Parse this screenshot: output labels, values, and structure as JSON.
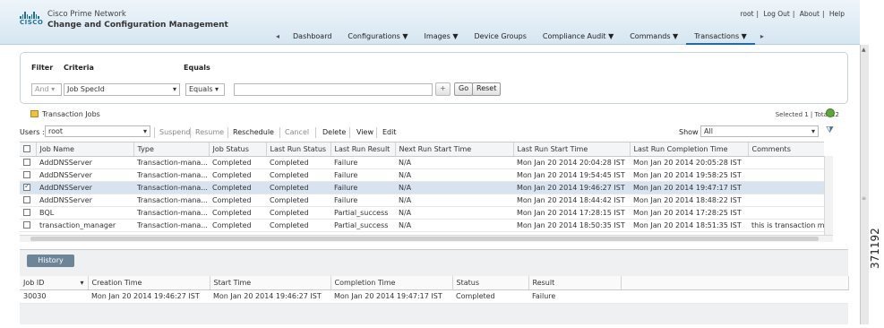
{
  "header": {
    "brand_line1": "Cisco Prime Network",
    "brand_line2": "Change and Configuration Management",
    "logo_text": "CISCO",
    "top_links": [
      "root",
      "Log Out",
      "About",
      "Help"
    ],
    "nav": [
      "Dashboard",
      "Configurations ▼",
      "Images ▼",
      "Device Groups",
      "Compliance Audit ▼",
      "Commands ▼",
      "Transactions ▼"
    ],
    "nav_left_arrow": "◂",
    "nav_right_arrow": "▸"
  },
  "filter": {
    "filter_label": "Filter",
    "criteria_label": "Criteria",
    "equals_label": "Equals",
    "and_select": "And",
    "criteria_select": "Job SpecId",
    "equals_select": "Equals",
    "value_input": "",
    "plus": "+",
    "go_label": "Go",
    "reset_label": "Reset"
  },
  "jobs": {
    "title": "Transaction Jobs",
    "selected_total": "Selected 1 | Total 12",
    "users_label": "Users :",
    "users_value": "root",
    "show_label": "Show",
    "show_value": "All",
    "actions": [
      {
        "label": "Suspend",
        "enabled": false
      },
      {
        "label": "Resume",
        "enabled": false
      },
      {
        "label": "Reschedule",
        "enabled": true
      },
      {
        "label": "Cancel",
        "enabled": false
      },
      {
        "label": "Delete",
        "enabled": true
      },
      {
        "label": "View",
        "enabled": true
      },
      {
        "label": "Edit",
        "enabled": true
      }
    ],
    "columns": [
      "Job Name",
      "Type",
      "Job Status",
      "Last Run Status",
      "Last Run Result",
      "Next Run Start Time",
      "Last Run Start Time",
      "Last Run Completion Time",
      "Comments"
    ],
    "rows": [
      {
        "checked": false,
        "cells": [
          "AddDNSServer",
          "Transaction-mana...",
          "Completed",
          "Completed",
          "Failure",
          "N/A",
          "Mon Jan 20 2014 20:04:28 IST",
          "Mon Jan 20 2014 20:05:28 IST",
          ""
        ]
      },
      {
        "checked": false,
        "cells": [
          "AddDNSServer",
          "Transaction-mana...",
          "Completed",
          "Completed",
          "Failure",
          "N/A",
          "Mon Jan 20 2014 19:54:45 IST",
          "Mon Jan 20 2014 19:58:25 IST",
          ""
        ]
      },
      {
        "checked": true,
        "cells": [
          "AddDNSServer",
          "Transaction-mana...",
          "Completed",
          "Completed",
          "Failure",
          "N/A",
          "Mon Jan 20 2014 19:46:27 IST",
          "Mon Jan 20 2014 19:47:17 IST",
          ""
        ]
      },
      {
        "checked": false,
        "cells": [
          "AddDNSServer",
          "Transaction-mana...",
          "Completed",
          "Completed",
          "Failure",
          "N/A",
          "Mon Jan 20 2014 18:44:42 IST",
          "Mon Jan 20 2014 18:48:22 IST",
          ""
        ]
      },
      {
        "checked": false,
        "cells": [
          "BQL",
          "Transaction-mana...",
          "Completed",
          "Completed",
          "Partial_success",
          "N/A",
          "Mon Jan 20 2014 17:28:15 IST",
          "Mon Jan 20 2014 17:28:25 IST",
          ""
        ]
      },
      {
        "checked": false,
        "cells": [
          "transaction_manager",
          "Transaction-mana...",
          "Completed",
          "Completed",
          "Partial_success",
          "N/A",
          "Mon Jan 20 2014 18:50:35 IST",
          "Mon Jan 20 2014 18:51:35 IST",
          "this is transaction man..."
        ]
      }
    ]
  },
  "history": {
    "tab_label": "History",
    "columns": [
      "Job ID",
      "Creation Time",
      "Start Time",
      "Completion Time",
      "Status",
      "Result"
    ],
    "rows": [
      [
        "30030",
        "Mon Jan 20 2014 19:46:27 IST",
        "Mon Jan 20 2014 19:46:27 IST",
        "Mon Jan 20 2014 19:47:17 IST",
        "Completed",
        "Failure"
      ]
    ]
  },
  "figure_id": "371192",
  "colors": {
    "link": "#2a76b8",
    "selected_row": "#d7e3ee",
    "history_tab": "#6d8597",
    "refresh": "#5aa83a"
  }
}
